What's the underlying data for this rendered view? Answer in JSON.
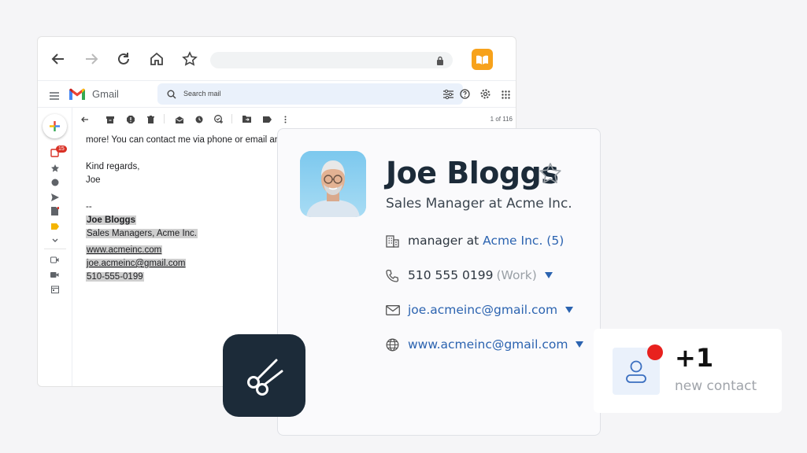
{
  "gmail": {
    "wordmark": "Gmail",
    "search_placeholder": "Search mail",
    "inbox_badge": "15",
    "pager": "1 of 116"
  },
  "email": {
    "line1": "more! You can contact me via phone or email an",
    "regards": "Kind regards,",
    "signoff": "Joe",
    "dashes": "--",
    "sig_name": "Joe Bloggs",
    "sig_title": "Sales Managers, Acme Inc.",
    "sig_web": "www.acmeinc.com",
    "sig_email": "joe.acmeinc@gmail.com",
    "sig_phone": "510-555-0199"
  },
  "contact": {
    "name": "Joe Bloggs",
    "role": "Sales Manager at Acme Inc.",
    "company_prefix": "manager at",
    "company": "Acme Inc. (5)",
    "phone": "510 555 0199",
    "phone_type": "(Work)",
    "email": "joe.acmeinc@gmail.com",
    "website": "www.acmeinc@gmail.com"
  },
  "toast": {
    "count": "+1",
    "label": "new contact"
  },
  "colors": {
    "accent": "#2b63b0",
    "dark": "#1c2b39",
    "alert": "#e8211e",
    "extension": "#f7a21b"
  }
}
